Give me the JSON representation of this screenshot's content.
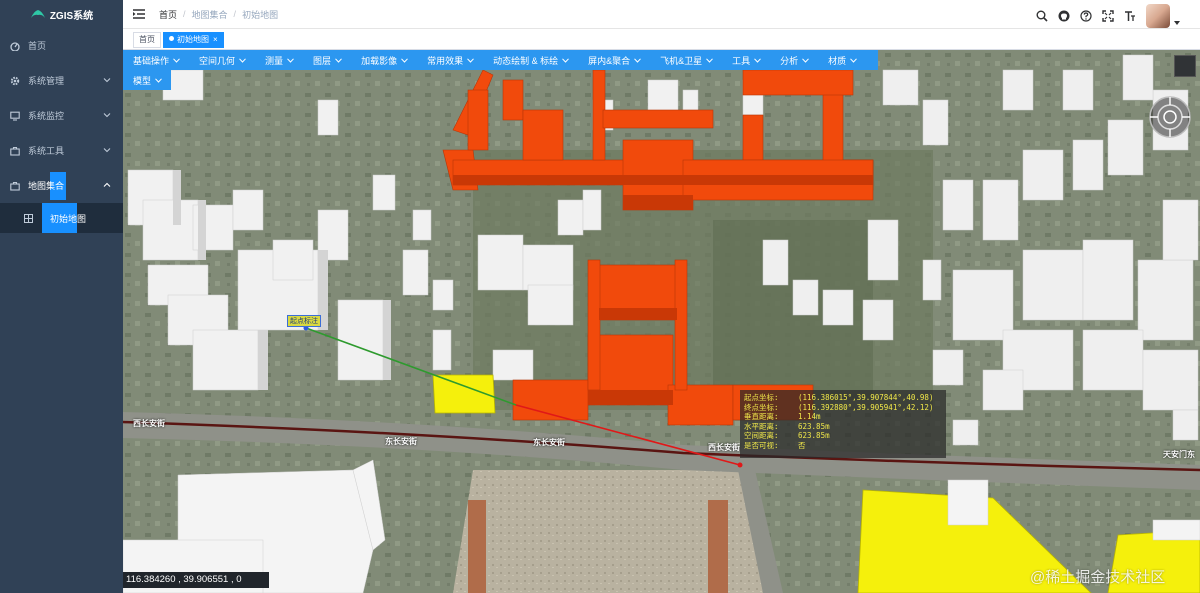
{
  "sidebar": {
    "brand": "ZGIS系统",
    "items": [
      {
        "label": "首页",
        "icon": "dashboard-icon"
      },
      {
        "label": "系统管理",
        "icon": "gear-icon"
      },
      {
        "label": "系统监控",
        "icon": "monitor-icon"
      },
      {
        "label": "系统工具",
        "icon": "toolbox-icon"
      },
      {
        "label": "地图集合",
        "icon": "map-collection-icon"
      }
    ],
    "subitems": [
      {
        "label": "初始地图",
        "icon": "grid-icon"
      }
    ]
  },
  "header": {
    "breadcrumb": [
      "首页",
      "地图集合",
      "初始地图"
    ]
  },
  "tags": [
    {
      "label": "首页",
      "active": false
    },
    {
      "label": "初始地图",
      "active": true,
      "close": "×"
    }
  ],
  "toolbar": {
    "items": [
      "基础操作",
      "空间几何",
      "测量",
      "图层",
      "加载影像",
      "常用效果",
      "动态绘制 & 标绘",
      "屏内&聚合",
      "飞机&卫星",
      "工具",
      "分析",
      "材质"
    ],
    "items_row2": [
      "模型"
    ]
  },
  "map": {
    "label_tag": "起点标注",
    "road_labels": [
      "西长安街",
      "东长安街",
      "西长安街",
      "东长安街",
      "天安门东"
    ],
    "info_panel": [
      {
        "key": "起点坐标:",
        "value": "(116.386015°,39.907844°,40.98)"
      },
      {
        "key": "终点坐标:",
        "value": "(116.392880°,39.905941°,42.12)"
      },
      {
        "key": "垂直距离:",
        "value": "1.14m"
      },
      {
        "key": "水平距离:",
        "value": "623.85m"
      },
      {
        "key": "空间距离:",
        "value": "623.85m"
      },
      {
        "key": "是否可视:",
        "value": "否"
      }
    ],
    "coordinates": "116.384260 , 39.906551 , 0"
  },
  "watermark": "@稀土掘金技术社区",
  "colors": {
    "sidebar_bg": "#304156",
    "toolbar_bg": "#2c97f0",
    "active_tag": "#1890ff",
    "wall_orange": "#f14a0c",
    "highlight_yellow": "#f5f00c",
    "info_text": "#f1e84a"
  }
}
